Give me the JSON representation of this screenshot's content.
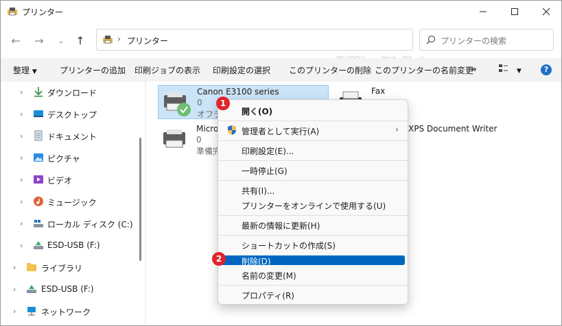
{
  "window": {
    "title": "プリンター"
  },
  "address": {
    "crumb": "プリンター"
  },
  "search": {
    "placeholder": "プリンターの検索"
  },
  "watermark": "BillionWallet.com",
  "toolbar": {
    "organize": "整理",
    "add_printer": "プリンターの追加",
    "print_jobs": "印刷ジョブの表示",
    "select_print_settings": "印刷設定の選択",
    "remove_printer": "このプリンターの削除",
    "rename_printer": "このプリンターの名前変更",
    "more": "»"
  },
  "sidebar": {
    "items": [
      {
        "label": "ダウンロード",
        "icon": "download-icon"
      },
      {
        "label": "デスクトップ",
        "icon": "desktop-icon"
      },
      {
        "label": "ドキュメント",
        "icon": "documents-icon"
      },
      {
        "label": "ピクチャ",
        "icon": "pictures-icon"
      },
      {
        "label": "ビデオ",
        "icon": "video-icon"
      },
      {
        "label": "ミュージック",
        "icon": "music-icon"
      },
      {
        "label": "ローカル ディスク (C:)",
        "icon": "drive-icon"
      },
      {
        "label": "ESD-USB (F:)",
        "icon": "usb-drive-icon"
      },
      {
        "label": "ライブラリ",
        "icon": "library-icon"
      },
      {
        "label": "ESD-USB (F:)",
        "icon": "usb-drive-icon"
      },
      {
        "label": "ネットワーク",
        "icon": "network-icon"
      }
    ]
  },
  "printers": [
    {
      "name": "Canon E3100 series",
      "line1": "0",
      "line2": "オフライ"
    },
    {
      "name": "Fax",
      "line1": "",
      "line2": ""
    },
    {
      "name": "Micro",
      "line1": "0",
      "line2": "準備完"
    },
    {
      "name": "XPS Document Writer",
      "line1": "",
      "line2": ""
    }
  ],
  "context_menu": {
    "open": "開く(O)",
    "run_as_admin": "管理者として実行(A)",
    "print_settings": "印刷設定(E)...",
    "pause": "一時停止(G)",
    "share": "共有(I)...",
    "use_online": "プリンターをオンラインで使用する(U)",
    "refresh": "最新の情報に更新(H)",
    "create_shortcut": "ショートカットの作成(S)",
    "delete": "削除(D)",
    "rename": "名前の変更(M)",
    "properties": "プロパティ(R)"
  },
  "badges": {
    "one": "1",
    "two": "2"
  },
  "colors": {
    "accent": "#0067c0",
    "badge": "#e0242b",
    "selection": "#cce4f7"
  }
}
